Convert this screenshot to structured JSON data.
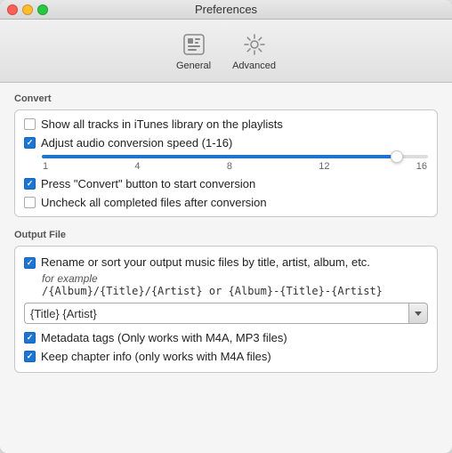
{
  "window": {
    "title": "Preferences",
    "buttons": {
      "close": "close",
      "minimize": "minimize",
      "maximize": "maximize"
    }
  },
  "toolbar": {
    "tabs": [
      {
        "id": "general",
        "label": "General",
        "icon": "general-icon"
      },
      {
        "id": "advanced",
        "label": "Advanced",
        "icon": "advanced-icon"
      }
    ]
  },
  "convert_section": {
    "title": "Convert",
    "items": [
      {
        "id": "show-all-tracks",
        "label": "Show all tracks in iTunes library on the playlists",
        "checked": false
      },
      {
        "id": "adjust-audio-speed",
        "label": "Adjust audio conversion speed (1-16)",
        "checked": true
      },
      {
        "id": "press-convert",
        "label": "Press \"Convert\" button to start conversion",
        "checked": true
      },
      {
        "id": "uncheck-completed",
        "label": "Uncheck all completed files after conversion",
        "checked": false
      }
    ],
    "slider": {
      "min": 1,
      "max": 16,
      "value": 16,
      "labels": [
        "1",
        "4",
        "8",
        "12",
        "16"
      ],
      "fill_percent": 92
    }
  },
  "output_section": {
    "title": "Output File",
    "rename_label": "Rename or sort your output music files by title, artist, album, etc.",
    "rename_checked": true,
    "example_label": "for example",
    "example_path": "/{Album}/{Title}/{Artist} or {Album}-{Title}-{Artist}",
    "format_value": "{Title} {Artist}",
    "format_placeholder": "{Title} {Artist}",
    "metadata_label": "Metadata tags (Only works with M4A, MP3 files)",
    "metadata_checked": true,
    "chapter_label": "Keep chapter info (only works with  M4A files)",
    "chapter_checked": true
  },
  "colors": {
    "accent": "#1d75d2",
    "checkbox_checked_bg": "#1d75d2"
  }
}
